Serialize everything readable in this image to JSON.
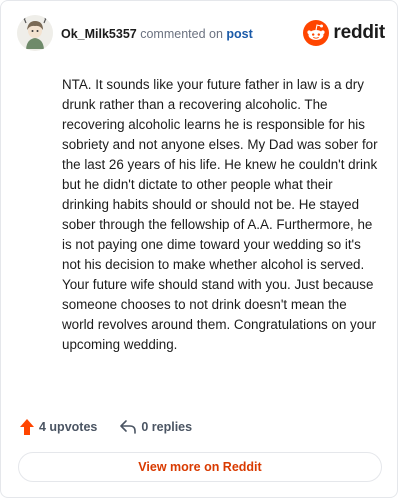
{
  "header": {
    "username": "Ok_Milk5357",
    "action_text": "commented on",
    "target": "post",
    "brand_name": "reddit"
  },
  "comment": {
    "body": "NTA. It sounds like your future father in law is a dry drunk rather than a recovering alcoholic. The recovering alcoholic learns he is responsible for his sobriety and not anyone elses. My Dad was sober for the last 26 years of his life. He knew he couldn't drink but he didn't dictate to other people what their drinking habits should or should not be. He stayed sober through the fellowship of A.A. Furthermore, he is not paying one dime toward your wedding so it's not his decision to make whether alcohol is served. Your future wife should stand with you. Just because someone chooses to not drink doesn't mean the world revolves around them. Congratulations on your upcoming wedding."
  },
  "actions": {
    "upvotes_label": "4 upvotes",
    "replies_label": "0 replies"
  },
  "footer": {
    "view_more_label": "View more on Reddit"
  },
  "icons": {
    "avatar": "user-avatar",
    "brand": "reddit-snoo-icon",
    "upvote": "upvote-arrow-icon",
    "reply": "reply-arrow-icon"
  },
  "colors": {
    "brand_orange": "#ff4500",
    "link_blue": "#1a5aa8",
    "cta_orange": "#d93a00",
    "upvote_orange": "#ff4500"
  }
}
